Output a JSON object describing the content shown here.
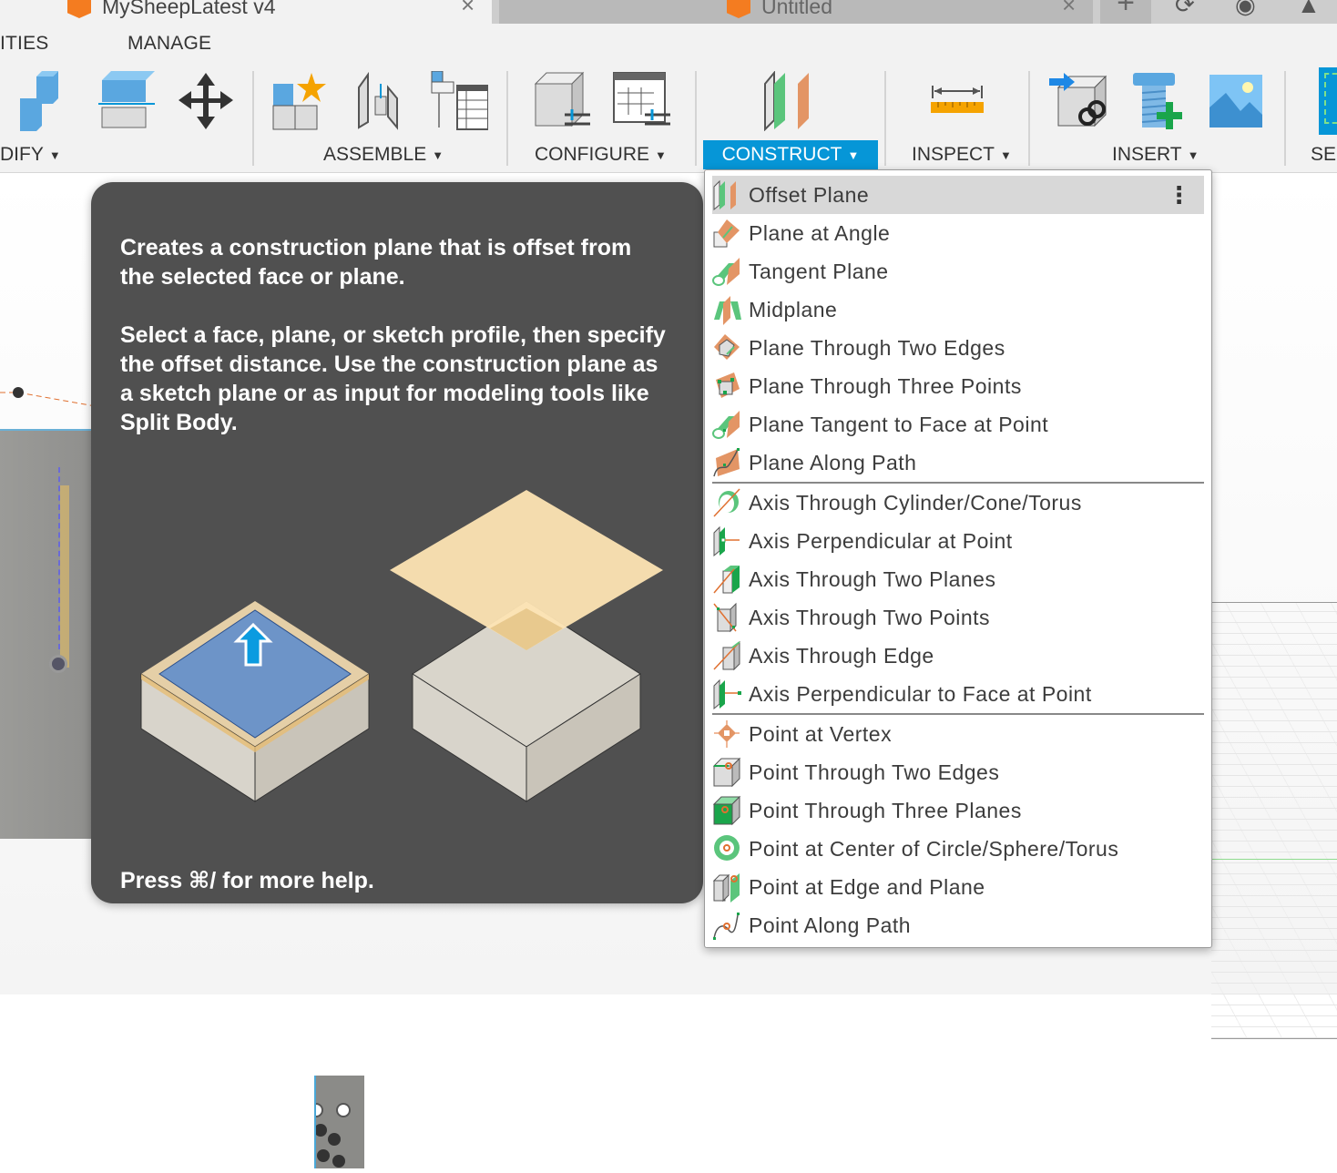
{
  "tabs": [
    {
      "title": "MySheepLatest v4",
      "active": true,
      "close_icon": "×"
    },
    {
      "title": "Untitled",
      "active": false,
      "close_icon": "×"
    }
  ],
  "tab_plus": "+",
  "ribbon": {
    "tabs": [
      "ITIES",
      "MANAGE"
    ],
    "groups": [
      {
        "label": "DIFY",
        "caret": "▼",
        "active": false
      },
      {
        "label": "ASSEMBLE",
        "caret": "▼",
        "active": false
      },
      {
        "label": "CONFIGURE",
        "caret": "▼",
        "active": false
      },
      {
        "label": "CONSTRUCT",
        "caret": "▼",
        "active": true
      },
      {
        "label": "INSPECT",
        "caret": "▼",
        "active": false
      },
      {
        "label": "INSERT",
        "caret": "▼",
        "active": false
      },
      {
        "label": "SEL",
        "caret": "",
        "active": false
      }
    ],
    "accent": "#0696d7"
  },
  "tooltip": {
    "paragraph1": "Creates a construction plane that is offset from the selected face or plane.",
    "paragraph2": "Select a face, plane, or sketch profile, then specify the offset distance. Use the construction plane as a sketch plane or as input for modeling tools like Split Body.",
    "help": "Press ⌘/ for more help."
  },
  "menu": {
    "more_icon": "⋮",
    "sections": [
      {
        "items": [
          {
            "label": "Offset Plane",
            "icon": "offset-plane-icon",
            "highlighted": true
          },
          {
            "label": "Plane at Angle",
            "icon": "plane-at-angle-icon"
          },
          {
            "label": "Tangent Plane",
            "icon": "tangent-plane-icon"
          },
          {
            "label": "Midplane",
            "icon": "midplane-icon"
          },
          {
            "label": "Plane Through Two Edges",
            "icon": "plane-two-edges-icon"
          },
          {
            "label": "Plane Through Three Points",
            "icon": "plane-three-points-icon"
          },
          {
            "label": "Plane Tangent to Face at Point",
            "icon": "plane-tangent-face-point-icon"
          },
          {
            "label": "Plane Along Path",
            "icon": "plane-along-path-icon"
          }
        ]
      },
      {
        "items": [
          {
            "label": "Axis Through Cylinder/Cone/Torus",
            "icon": "axis-cylinder-icon"
          },
          {
            "label": "Axis Perpendicular at Point",
            "icon": "axis-perpendicular-point-icon"
          },
          {
            "label": "Axis Through Two Planes",
            "icon": "axis-two-planes-icon"
          },
          {
            "label": "Axis Through Two Points",
            "icon": "axis-two-points-icon"
          },
          {
            "label": "Axis Through Edge",
            "icon": "axis-edge-icon"
          },
          {
            "label": "Axis Perpendicular to Face at Point",
            "icon": "axis-perpendicular-face-icon"
          }
        ]
      },
      {
        "items": [
          {
            "label": "Point at Vertex",
            "icon": "point-vertex-icon"
          },
          {
            "label": "Point Through Two Edges",
            "icon": "point-two-edges-icon"
          },
          {
            "label": "Point Through Three Planes",
            "icon": "point-three-planes-icon"
          },
          {
            "label": "Point at Center of Circle/Sphere/Torus",
            "icon": "point-center-icon"
          },
          {
            "label": "Point at Edge and Plane",
            "icon": "point-edge-plane-icon"
          },
          {
            "label": "Point Along Path",
            "icon": "point-along-path-icon"
          }
        ]
      }
    ]
  }
}
